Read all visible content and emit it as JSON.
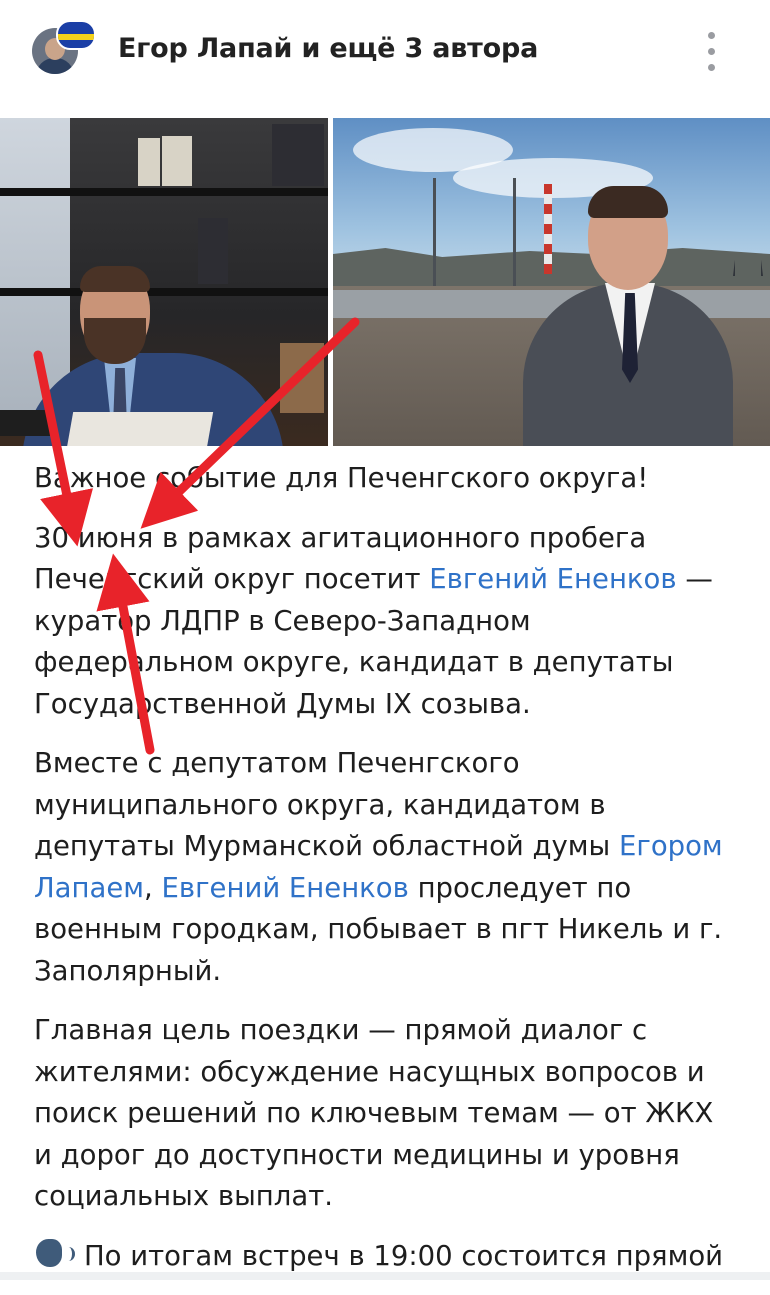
{
  "header": {
    "authors_label": "Егор Лапай и ещё 3 автора",
    "avatar_icon": "user-avatar",
    "badge_icon": "ldpr-badge",
    "more_icon": "vertical-dots-icon"
  },
  "photos": [
    {
      "name": "photo-egor-lapay",
      "description_icon": "man-at-desk-photo"
    },
    {
      "name": "photo-evgeniy-enenkov",
      "description_icon": "man-outdoors-photo"
    }
  ],
  "post": {
    "p1": "Важное событие для Печенгского округа!",
    "p2_pre": "30 июня в рамках агитационного пробега Печенгский округ посетит ",
    "p2_link": "Евгений Ененков",
    "p2_post": " — куратор ЛДПР в Северо-Западном федеральном округе, кандидат в депутаты Государственной Думы IX созыва.",
    "p3_pre": "Вместе с депутатом Печенгского муниципального округа, кандидатом в депутаты Мурманской областной думы ",
    "p3_link1": "Егором Лапаем",
    "p3_mid": ", ",
    "p3_link2": "Евгений Ененков",
    "p3_post": " проследует по военным городкам, побывает в пгт Никель и г. Заполярный.",
    "p4": "Главная цель поездки — прямой диалог с жителями: обсуждение насущных вопросов и поиск решений по ключевым темам — от ЖКХ и дорог до доступности медицины и уровня социальных выплат.",
    "p5": "По итогам встреч в 19:00 состоится прямой",
    "p5_icon": "speaking-head-icon"
  },
  "colors": {
    "link": "#2f72c8",
    "text": "#1e1e1e",
    "arrow": "#e8232a"
  }
}
